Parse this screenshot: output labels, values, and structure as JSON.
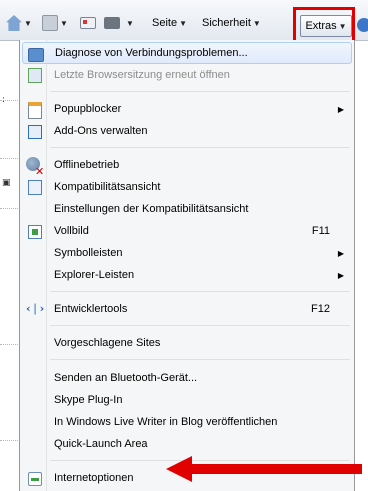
{
  "toolbar": {
    "items": [
      {
        "icon": "home-icon"
      },
      {
        "icon": "feed-icon"
      },
      {
        "icon": "mail-icon"
      },
      {
        "icon": "print-icon"
      }
    ],
    "seite_label": "Seite",
    "sicherheit_label": "Sicherheit",
    "extras_label": "Extras",
    "highlight_color": "#e00000"
  },
  "menu": {
    "items": [
      {
        "label": "Diagnose von Verbindungsproblemen...",
        "icon": "network-diagnose-icon",
        "disabled": false,
        "highlighted": true
      },
      {
        "label": "Letzte Browsersitzung erneut öffnen",
        "icon": "reopen-session-icon",
        "disabled": true
      },
      {
        "label": "Popupblocker",
        "icon": "popup-blocker-icon",
        "submenu": true
      },
      {
        "label": "Add-Ons verwalten",
        "icon": "addons-icon"
      },
      {
        "label": "Offlinebetrieb",
        "icon": "offline-icon"
      },
      {
        "label": "Kompatibilitätsansicht",
        "icon": "compat-view-icon"
      },
      {
        "label": "Einstellungen der Kompatibilitätsansicht"
      },
      {
        "label": "Vollbild",
        "icon": "fullscreen-icon",
        "shortcut": "F11"
      },
      {
        "label": "Symbolleisten",
        "submenu": true
      },
      {
        "label": "Explorer-Leisten",
        "submenu": true
      },
      {
        "label": "Entwicklertools",
        "icon": "dev-tools-icon",
        "shortcut": "F12"
      },
      {
        "label": "Vorgeschlagene Sites"
      },
      {
        "label": "Senden an Bluetooth-Gerät..."
      },
      {
        "label": "Skype Plug-In"
      },
      {
        "label": "In Windows Live Writer in Blog veröffentlichen"
      },
      {
        "label": "Quick-Launch Area"
      },
      {
        "label": "Internetoptionen",
        "icon": "internet-options-icon"
      }
    ]
  },
  "annotation": {
    "arrow_color": "#e00000",
    "points_to": "Internetoptionen"
  }
}
